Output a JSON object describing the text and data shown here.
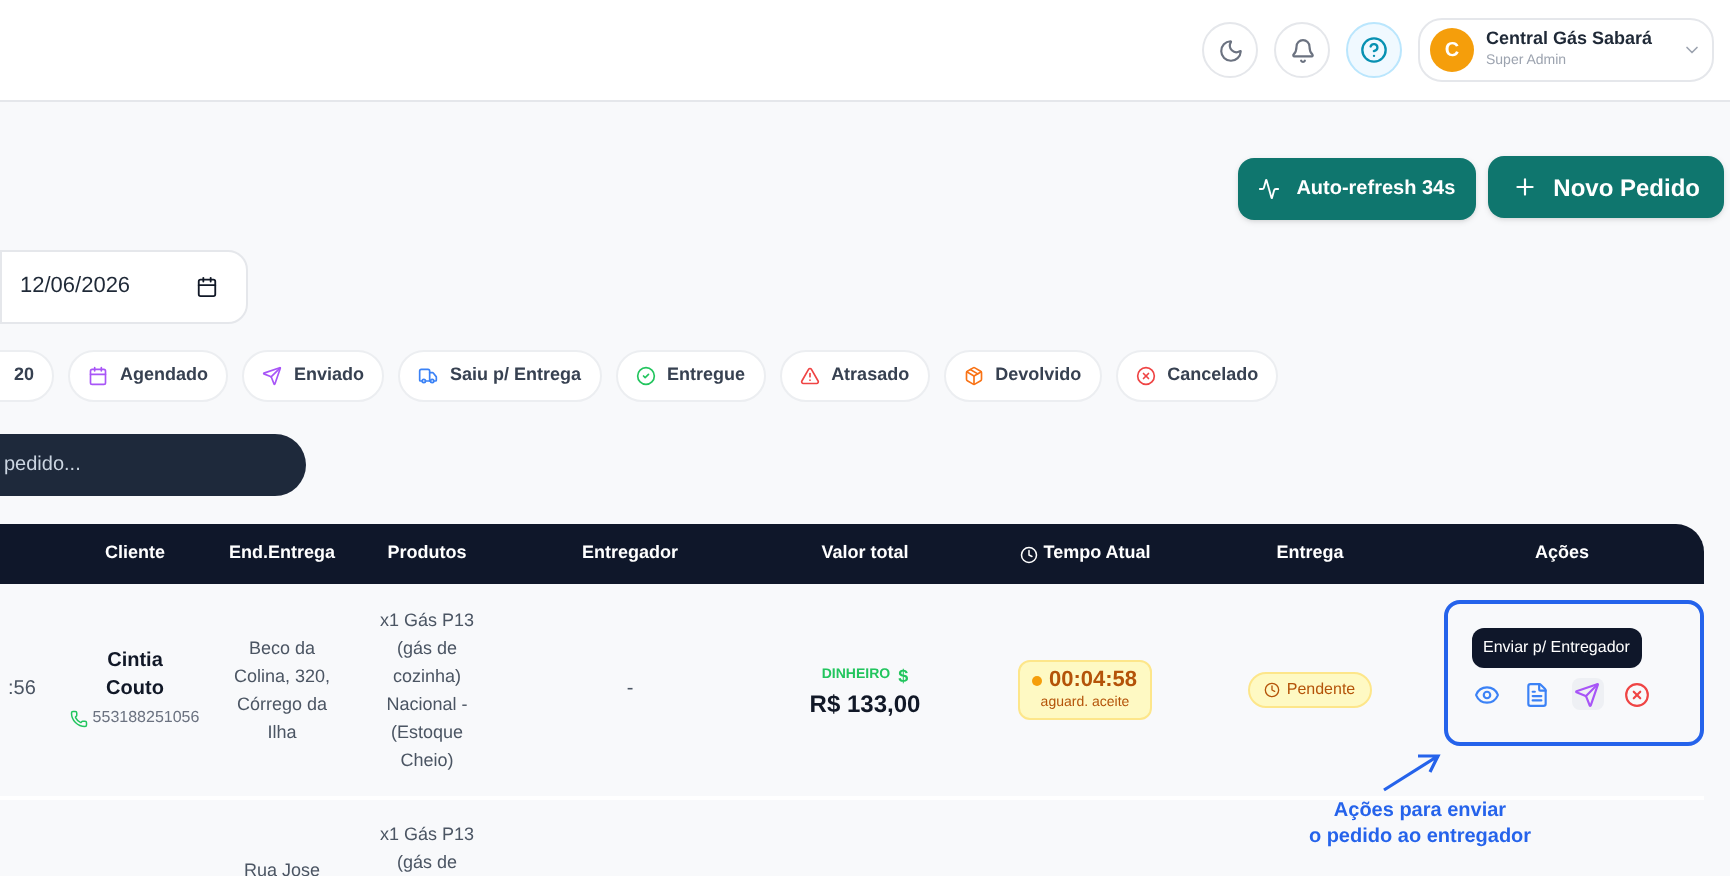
{
  "header": {
    "user": {
      "initial": "C",
      "name": "Central Gás Sabará",
      "role": "Super Admin"
    }
  },
  "toolbar": [
    {
      "kind": "refresh",
      "label": "Auto-refresh 34s"
    },
    {
      "kind": "add",
      "label": "Novo Pedido"
    }
  ],
  "date_field": {
    "value": "12/06/2026"
  },
  "filters": [
    {
      "kind": "count",
      "label": "20"
    },
    {
      "kind": "calendar",
      "label": "Agendado",
      "color": "#a855f7"
    },
    {
      "kind": "send",
      "label": "Enviado",
      "color": "#a855f7"
    },
    {
      "kind": "truck",
      "label": "Saiu p/ Entrega",
      "color": "#3b82f6"
    },
    {
      "kind": "check",
      "label": "Entregue",
      "color": "#22c55e"
    },
    {
      "kind": "alert",
      "label": "Atrasado",
      "color": "#ef4444"
    },
    {
      "kind": "box",
      "label": "Devolvido",
      "color": "#f97316"
    },
    {
      "kind": "cancel",
      "label": "Cancelado",
      "color": "#ef4444"
    }
  ],
  "search": {
    "placeholder": "pedido..."
  },
  "table": {
    "columns": [
      "Cliente",
      "End.Entrega",
      "Produtos",
      "Entregador",
      "Valor total",
      "Tempo Atual",
      "Entrega",
      "Ações"
    ],
    "rows": [
      {
        "time": ":56",
        "client": "Cintia Couto",
        "phone": "553188251056",
        "address": "Beco da Colina, 320, Córrego da Ilha",
        "products": "x1 Gás P13 (gás de cozinha) Nacional - (Estoque Cheio)",
        "courier": "-",
        "payment": "DINHEIRO",
        "payment_sign": "$",
        "total": "R$ 133,00",
        "timer": "00:04:58",
        "timer_note": "aguard. aceite",
        "delivery": "Pendente",
        "actions": [
          {
            "kind": "view"
          },
          {
            "kind": "doc"
          },
          {
            "kind": "send",
            "tooltip": "Enviar p/ Entregador"
          },
          {
            "kind": "cancel"
          }
        ]
      },
      {
        "address": "Rua Jose",
        "products": "x1 Gás P13 (gás de"
      }
    ]
  },
  "annotation": {
    "lines": [
      "Ações para enviar",
      "o pedido ao entregador"
    ]
  }
}
